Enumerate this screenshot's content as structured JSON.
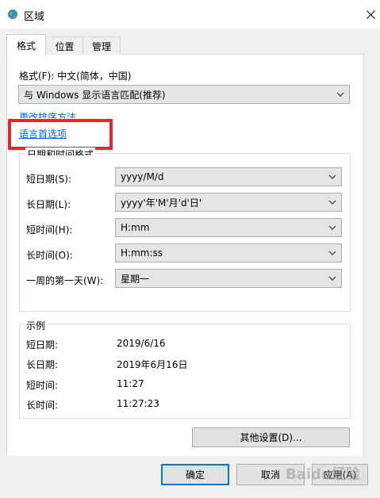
{
  "window": {
    "title": "区域"
  },
  "tabs": [
    {
      "label": "格式"
    },
    {
      "label": "位置"
    },
    {
      "label": "管理"
    }
  ],
  "format": {
    "label": "格式(F): 中文(简体，中国)",
    "selected": "与 Windows 显示语言匹配(推荐)"
  },
  "links": {
    "sort": "更改排序方法",
    "language": "语言首选项"
  },
  "datetime": {
    "group_title": "日期和时间格式",
    "fields": [
      {
        "label": "短日期(S):",
        "value": "yyyy/M/d"
      },
      {
        "label": "长日期(L):",
        "value": "yyyy'年'M'月'd'日'"
      },
      {
        "label": "短时间(H):",
        "value": "H:mm"
      },
      {
        "label": "长时间(O):",
        "value": "H:mm:ss"
      },
      {
        "label": "一周的第一天(W):",
        "value": "星期一"
      }
    ]
  },
  "example": {
    "group_title": "示例",
    "rows": [
      {
        "label": "短日期:",
        "value": "2019/6/16"
      },
      {
        "label": "长日期:",
        "value": "2019年6月16日"
      },
      {
        "label": "短时间:",
        "value": "11:27"
      },
      {
        "label": "长时间:",
        "value": "11:27:23"
      }
    ]
  },
  "buttons": {
    "other_settings": "其他设置(D)...",
    "ok": "确定",
    "cancel": "取消",
    "apply": "应用(A)"
  },
  "watermark": "Baidu经验",
  "colors": {
    "link": "#0066cc",
    "highlight": "#e0292a",
    "accent": "#0078d7"
  }
}
